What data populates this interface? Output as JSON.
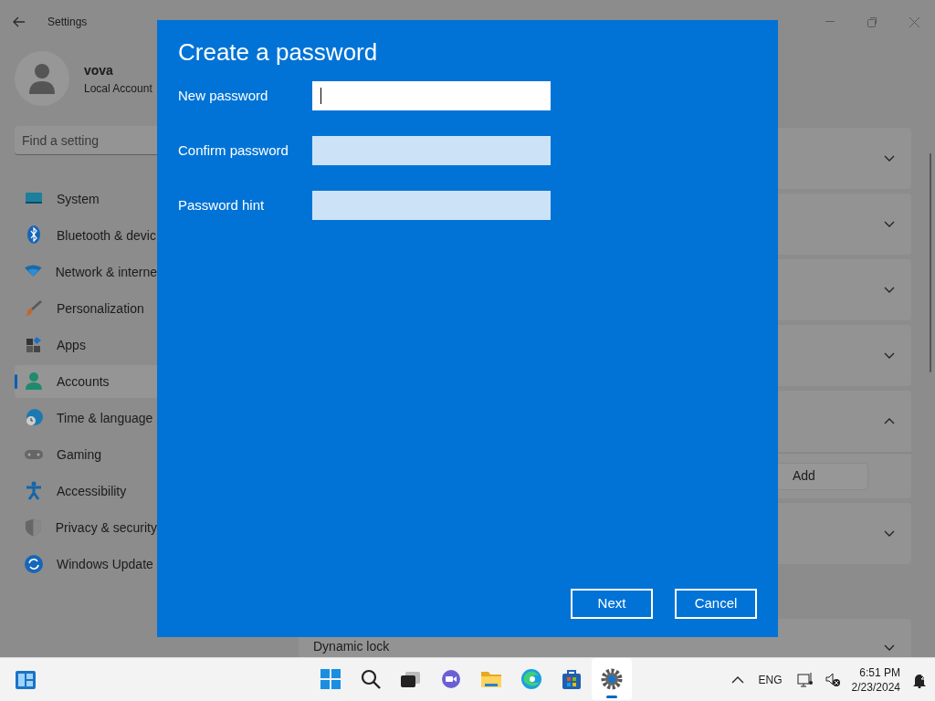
{
  "window": {
    "title": "Settings"
  },
  "profile": {
    "name": "vova",
    "account": "Local Account"
  },
  "search": {
    "placeholder": "Find a setting"
  },
  "sidebar": {
    "items": [
      {
        "label": "System",
        "selected": false
      },
      {
        "label": "Bluetooth & devic",
        "selected": false
      },
      {
        "label": "Network & interne",
        "selected": false
      },
      {
        "label": "Personalization",
        "selected": false
      },
      {
        "label": "Apps",
        "selected": false
      },
      {
        "label": "Accounts",
        "selected": true
      },
      {
        "label": "Time & language",
        "selected": false
      },
      {
        "label": "Gaming",
        "selected": false
      },
      {
        "label": "Accessibility",
        "selected": false
      },
      {
        "label": "Privacy & security",
        "selected": false
      },
      {
        "label": "Windows Update",
        "selected": false
      }
    ]
  },
  "cards": [
    {
      "expanded": false
    },
    {
      "expanded": false
    },
    {
      "expanded": false
    },
    {
      "expanded": false
    },
    {
      "expanded": true,
      "button": "Add"
    },
    {
      "expanded": false
    },
    {
      "expanded": false,
      "title": "Dynamic lock"
    }
  ],
  "dialog": {
    "title": "Create a password",
    "fields": [
      {
        "label": "New password",
        "focused": true
      },
      {
        "label": "Confirm password",
        "focused": false
      },
      {
        "label": "Password hint",
        "focused": false
      }
    ],
    "buttons": [
      "Next",
      "Cancel"
    ]
  },
  "taskbar": {
    "apps": [
      {
        "selected": false
      },
      {
        "selected": false
      },
      {
        "selected": false
      },
      {
        "selected": false
      },
      {
        "selected": false
      },
      {
        "selected": false
      },
      {
        "selected": false
      },
      {
        "selected": true
      }
    ],
    "language": "ENG",
    "time": "6:51 PM",
    "date": "2/23/2024"
  }
}
